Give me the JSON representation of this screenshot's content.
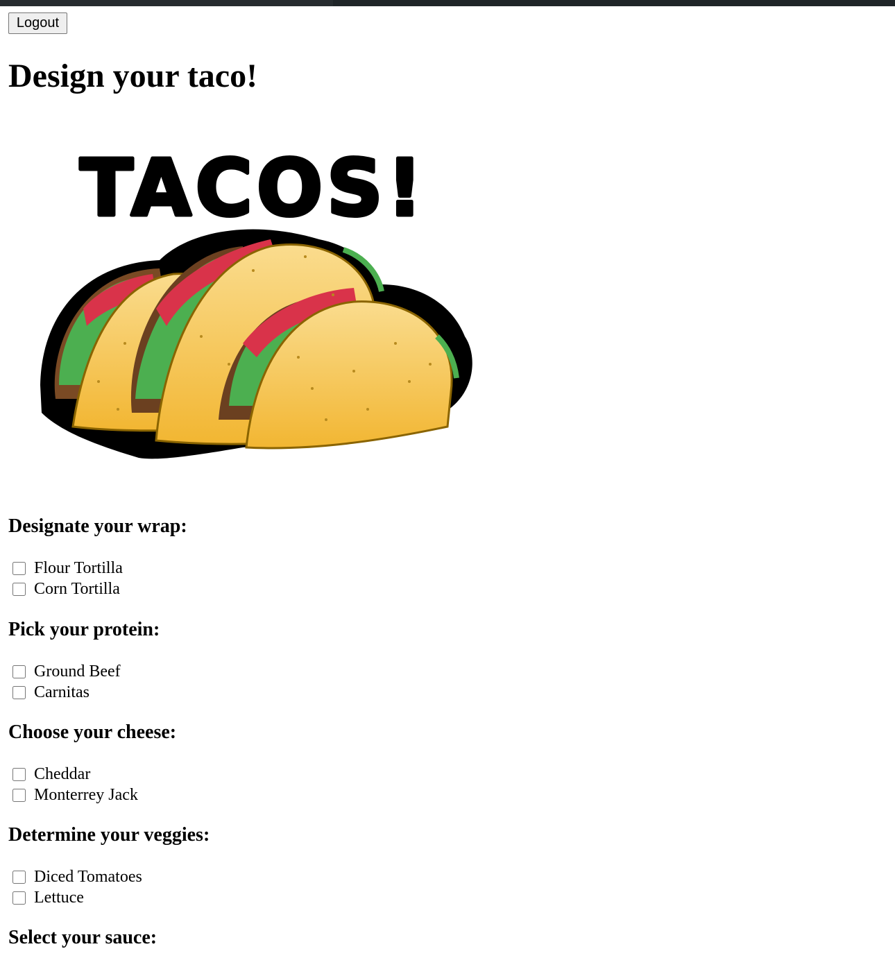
{
  "header": {
    "logout_label": "Logout"
  },
  "page": {
    "title": "Design your taco!"
  },
  "logo": {
    "text": "TACOS!"
  },
  "sections": [
    {
      "title": "Designate your wrap:",
      "options": [
        "Flour Tortilla",
        "Corn Tortilla"
      ]
    },
    {
      "title": "Pick your protein:",
      "options": [
        "Ground Beef",
        "Carnitas"
      ]
    },
    {
      "title": "Choose your cheese:",
      "options": [
        "Cheddar",
        "Monterrey Jack"
      ]
    },
    {
      "title": "Determine your veggies:",
      "options": [
        "Diced Tomatoes",
        "Lettuce"
      ]
    },
    {
      "title": "Select your sauce:",
      "options": []
    }
  ]
}
